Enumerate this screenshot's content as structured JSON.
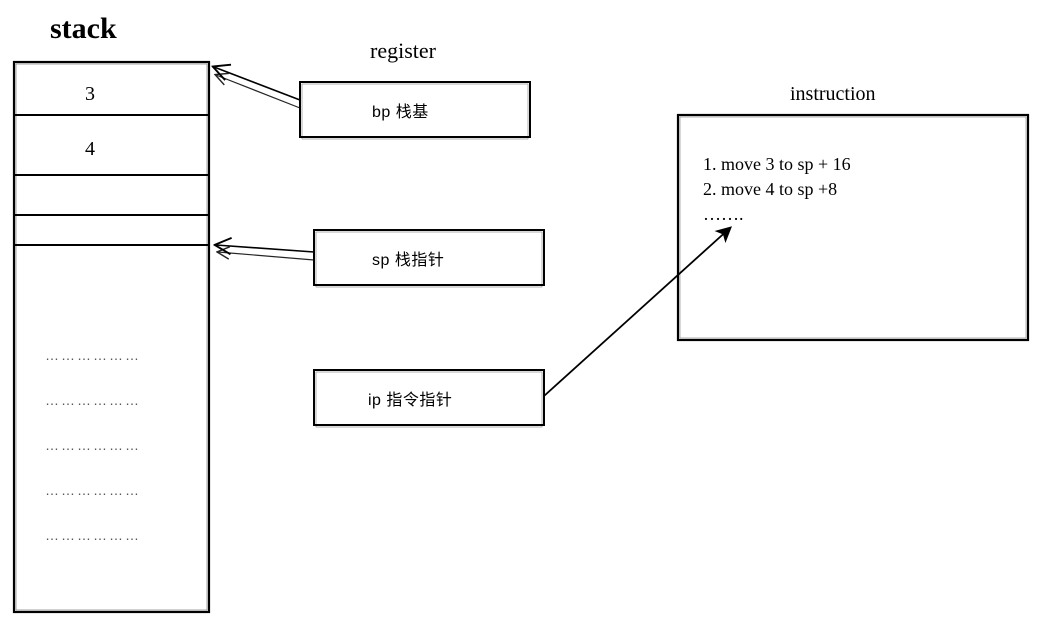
{
  "titles": {
    "stack": "stack",
    "register": "register",
    "instruction": "instruction"
  },
  "stack": {
    "cells": [
      "3",
      "4",
      "",
      ""
    ],
    "dots": [
      "………………",
      "………………",
      "………………",
      "………………",
      "………………"
    ]
  },
  "registers": {
    "bp": "bp 栈基",
    "sp": "sp 栈指针",
    "ip": "ip 指令指针"
  },
  "instructions": {
    "line1": "1. move 3 to sp + 16",
    "line2": "2. move 4 to sp +8",
    "line3": "……."
  }
}
